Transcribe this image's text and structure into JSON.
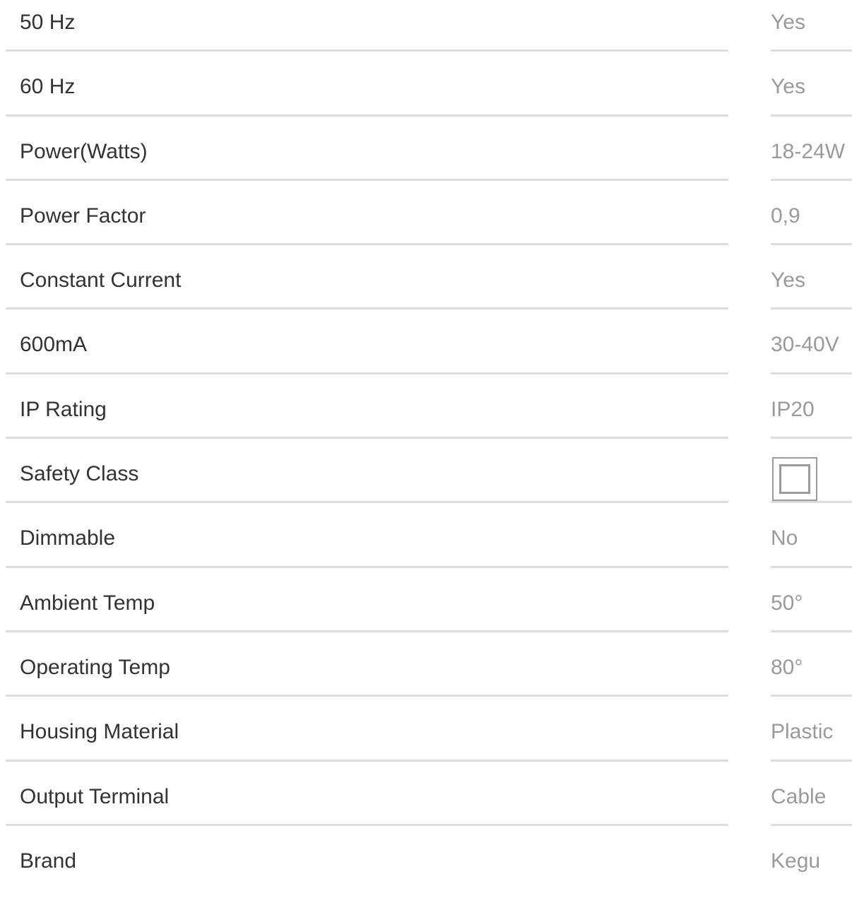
{
  "specs": [
    {
      "label": "50 Hz",
      "value": "Yes"
    },
    {
      "label": "60 Hz",
      "value": "Yes"
    },
    {
      "label": "Power(Watts)",
      "value": "18-24W"
    },
    {
      "label": "Power Factor",
      "value": "0,9"
    },
    {
      "label": "Constant Current",
      "value": "Yes"
    },
    {
      "label": "600mA",
      "value": "30-40V"
    },
    {
      "label": "IP Rating",
      "value": "IP20"
    },
    {
      "label": "Safety Class",
      "value": "",
      "icon": "double-insulation-icon"
    },
    {
      "label": "Dimmable",
      "value": "No"
    },
    {
      "label": "Ambient Temp",
      "value": "50°"
    },
    {
      "label": "Operating Temp",
      "value": "80°"
    },
    {
      "label": "Housing Material",
      "value": "Plastic"
    },
    {
      "label": "Output Terminal",
      "value": "Cable"
    },
    {
      "label": "Brand",
      "value": "Kegu"
    }
  ],
  "colors": {
    "label": "#333333",
    "value": "#9a9a9a",
    "rule": "#dddddd"
  }
}
